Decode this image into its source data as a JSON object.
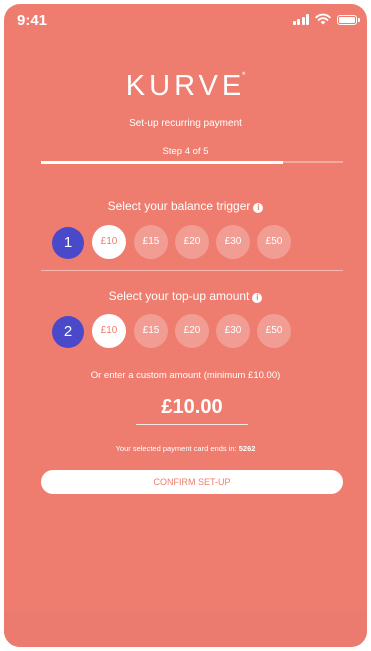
{
  "status": {
    "time": "9:41"
  },
  "brand": {
    "logo_text": "KURVE",
    "logo_mark": "*"
  },
  "header": {
    "subtitle": "Set-up recurring payment",
    "step_label": "Step 4 of 5",
    "progress": 0.8
  },
  "trigger": {
    "title": "Select your balance trigger",
    "marker": "1",
    "options": [
      "£10",
      "£15",
      "£20",
      "£30",
      "£50"
    ],
    "selected_index": 0
  },
  "topup": {
    "title": "Select your top-up amount",
    "marker": "2",
    "options": [
      "£10",
      "£15",
      "£20",
      "£30",
      "£50"
    ],
    "selected_index": 0
  },
  "custom": {
    "label": "Or enter a custom amount (minimum £10.00)",
    "amount": "£10.00"
  },
  "card": {
    "note": "Your selected payment card ends in:",
    "last4": "5262"
  },
  "confirm": {
    "label": "CONFIRM SET-UP"
  },
  "icons": {
    "info": "info-icon",
    "signal": "signal-icon",
    "wifi": "wifi-icon",
    "battery": "battery-icon"
  },
  "colors": {
    "background": "#EE7D6F",
    "marker": "#4A49C9",
    "accent": "#ffffff"
  }
}
